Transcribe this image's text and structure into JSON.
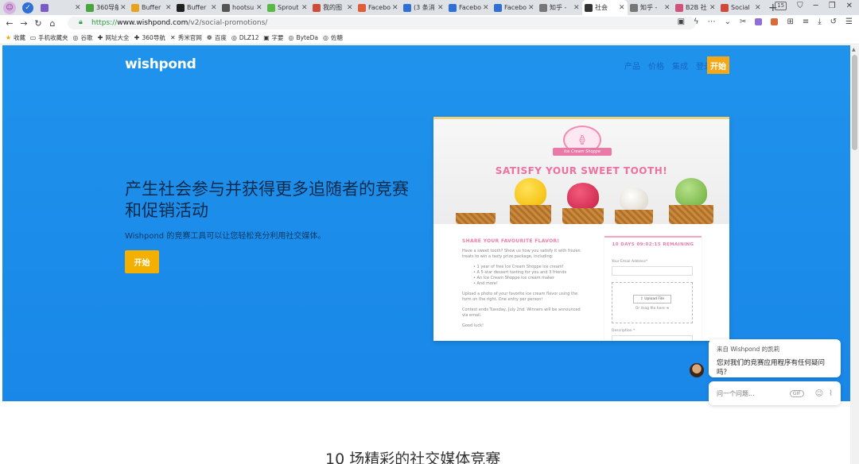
{
  "browser": {
    "tabs": [
      {
        "title": "",
        "color": "#7b59c7"
      },
      {
        "title": "360导航",
        "color": "#4aa63c"
      },
      {
        "title": "Buffer",
        "color": "#e8a21c"
      },
      {
        "title": "Buffer",
        "color": "#1f1f1f"
      },
      {
        "title": "hootsu",
        "color": "#555"
      },
      {
        "title": "Sprout",
        "color": "#59b944"
      },
      {
        "title": "我的图",
        "color": "#d04a3a"
      },
      {
        "title": "Facebo",
        "color": "#e25c3a"
      },
      {
        "title": "(3 条消",
        "color": "#2f6fd6"
      },
      {
        "title": "Facebo",
        "color": "#2f6fd6"
      },
      {
        "title": "Facebo",
        "color": "#2f6fd6"
      },
      {
        "title": "知乎 - ",
        "color": "#777"
      },
      {
        "title": "社会",
        "color": "#333"
      },
      {
        "title": "知乎 - ",
        "color": "#777"
      },
      {
        "title": "B2B 社",
        "color": "#d2527a"
      },
      {
        "title": "Social",
        "color": "#d04a3a"
      }
    ],
    "active_tab_index": 12,
    "tab_count": "15",
    "url_scheme": "https://",
    "url_host": "www.wishpond.com",
    "url_path": "/v2/social-promotions/",
    "bookmarks": [
      {
        "label": "收藏",
        "icon": "★"
      },
      {
        "label": "手机收藏夹",
        "icon": "▭"
      },
      {
        "label": "谷歌",
        "icon": "◎"
      },
      {
        "label": "网址大全",
        "icon": "✚"
      },
      {
        "label": "360导航",
        "icon": "✚"
      },
      {
        "label": "秀米官网",
        "icon": "✕"
      },
      {
        "label": "百度",
        "icon": "❁"
      },
      {
        "label": "DLZ12",
        "icon": "◎"
      },
      {
        "label": "字要",
        "icon": "▣"
      },
      {
        "label": "ByteDa",
        "icon": "◎"
      },
      {
        "label": "佐糖",
        "icon": "◎"
      }
    ]
  },
  "site": {
    "brand": "wishpond",
    "nav": [
      "产品",
      "价格",
      "集成",
      "登录"
    ],
    "nav_cta": "开始",
    "headline": "产生社会参与并获得更多追随者的竞赛和促销活动",
    "subline": "Wishpond 的竞赛工具可以让您轻松充分利用社交媒体。",
    "hero_cta": "开始",
    "section_title": "10 场精彩的社交媒体竞赛"
  },
  "preview": {
    "logo_label": "Ice Cream Shoppe",
    "headline": "SATISFY YOUR SWEET TOOTH!",
    "subheading": "SHARE YOUR FAVOURITE FLAVOR!",
    "intro": "Have a sweet tooth? Show us how you satisfy it with frozen treats to win a tasty prize package, including:",
    "bullets": [
      "1 year of free Ice Cream Shoppe ice cream!",
      "A 5-star dessert tasting for you and 3 friends",
      "An Ice Cream Shoppe ice cream maker",
      "And more!"
    ],
    "para2": "Upload a photo of your favorite ice cream flavor using the form on the right. One entry per person!",
    "para3": "Contest ends Tuesday, July 2nd. Winners will be announced via email.",
    "para4": "Good luck!",
    "form_header": "10 DAYS 09:02:15 REMAINING",
    "email_label": "Your Email Address*",
    "upload_label": "Upload File",
    "drag_label": "Or drag file here",
    "description_label": "Description *"
  },
  "chat": {
    "from": "来自 Wishpond 的凯莉",
    "message": "您对我们的竞赛应用程序有任何疑问吗？",
    "placeholder": "问一个问题...",
    "gif_label": "GIF"
  }
}
